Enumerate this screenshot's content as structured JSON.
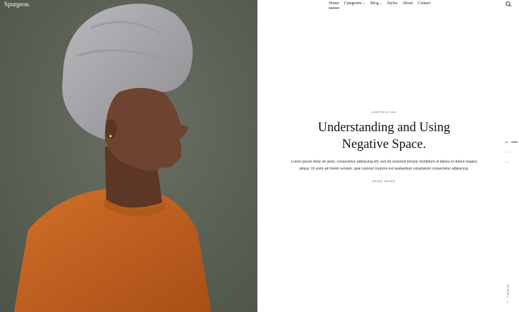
{
  "site": {
    "logo": "Spurgeon."
  },
  "nav": {
    "items": [
      {
        "label": "Home",
        "active": true,
        "has_dropdown": false
      },
      {
        "label": "Categories",
        "active": false,
        "has_dropdown": true
      },
      {
        "label": "Blog",
        "active": false,
        "has_dropdown": true
      },
      {
        "label": "Styles",
        "active": false,
        "has_dropdown": false
      },
      {
        "label": "About",
        "active": false,
        "has_dropdown": false
      },
      {
        "label": "Contact",
        "active": false,
        "has_dropdown": false
      }
    ],
    "caret": "⌄"
  },
  "article": {
    "category": "Inspiration",
    "title_line1": "Understanding and Using",
    "title_line2": "Negative Space.",
    "excerpt": "Lorem ipsum dolor sit amet, consectetur adipiscing elit, sed do eiusmod tempor incididunt ut labore et dolore magna aliqua. Ut enim ad minim veniam, quis nostrud corporis est laudantium voluptatum consectetur adipiscing.",
    "read_more": "Read More"
  },
  "slider": {
    "numbers": [
      "01",
      "02",
      "03"
    ],
    "active_index": 0
  },
  "scroll": {
    "label": "Scroll",
    "arrow": "↓"
  },
  "colors": {
    "background": "#ffffff",
    "hero_bg": "#5d6256",
    "headscarf": "#a9a8ad",
    "sweater": "#c8621e",
    "skin": "#6e4430"
  },
  "icons": {
    "search": "search-icon"
  }
}
